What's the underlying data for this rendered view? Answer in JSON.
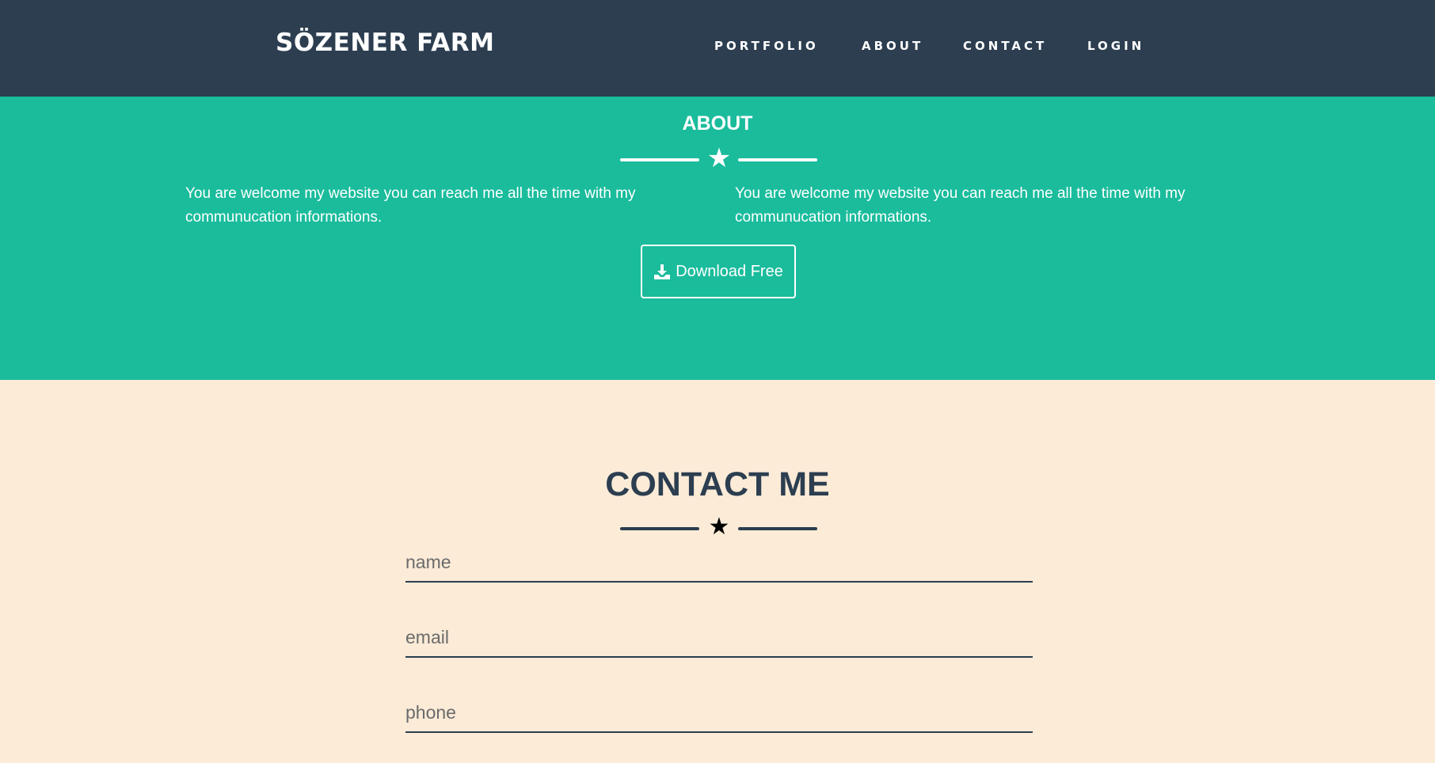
{
  "navbar": {
    "brand": "SÖZENER FARM",
    "links": [
      "PORTFOLIO",
      "ABOUT",
      "CONTACT",
      "LOGIN"
    ]
  },
  "about": {
    "title": "ABOUT",
    "divider_icon": "star-icon",
    "text_left": "You are welcome my website you can reach me all the time with my communucation informations.",
    "text_right": "You are welcome my website you can reach me all the time with my communucation informations.",
    "download_button": {
      "icon": "download-icon",
      "label": "Download Free"
    }
  },
  "contact": {
    "title": "CONTACT ME",
    "divider_icon": "star-icon",
    "fields": [
      {
        "value": "",
        "placeholder": "name"
      },
      {
        "value": "",
        "placeholder": "email"
      },
      {
        "value": "",
        "placeholder": "phone"
      }
    ]
  },
  "colors": {
    "navbar_bg": "#2c3e50",
    "about_bg": "#1abc9c",
    "contact_bg": "#fbebd7",
    "dark_text": "#2c3e50"
  }
}
